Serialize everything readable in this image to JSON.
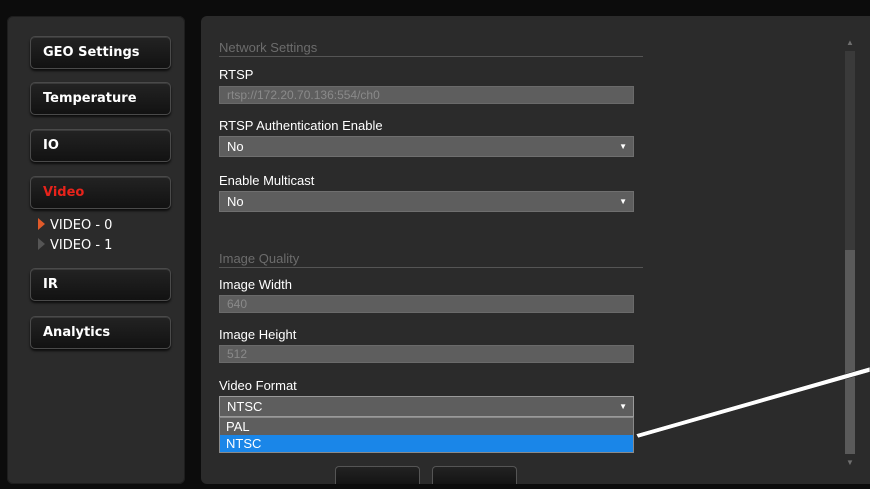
{
  "sidebar": {
    "buttons": [
      {
        "label": "GEO Settings"
      },
      {
        "label": "Temperature"
      },
      {
        "label": "IO"
      },
      {
        "label": "Video"
      },
      {
        "label": "IR"
      },
      {
        "label": "Analytics"
      }
    ],
    "video_items": [
      {
        "label": "VIDEO - 0"
      },
      {
        "label": "VIDEO - 1"
      }
    ]
  },
  "network": {
    "section_title": "Network Settings",
    "rtsp_label": "RTSP",
    "rtsp_value": "rtsp://172.20.70.136:554/ch0",
    "rtsp_auth_label": "RTSP Authentication Enable",
    "rtsp_auth_value": "No",
    "multicast_label": "Enable Multicast",
    "multicast_value": "No"
  },
  "image_quality": {
    "section_title": "Image Quality",
    "width_label": "Image Width",
    "width_value": "640",
    "height_label": "Image Height",
    "height_value": "512",
    "format_label": "Video Format",
    "format_value": "NTSC",
    "format_options": [
      "PAL",
      "NTSC"
    ],
    "format_selected": "NTSC"
  },
  "colors": {
    "active_nav": "#e8231b",
    "selected_option": "#1a86e8"
  },
  "icons": {
    "active_arrow": "triangle-right-orange",
    "inactive_arrow": "triangle-right-gray",
    "select_caret": "▼"
  }
}
